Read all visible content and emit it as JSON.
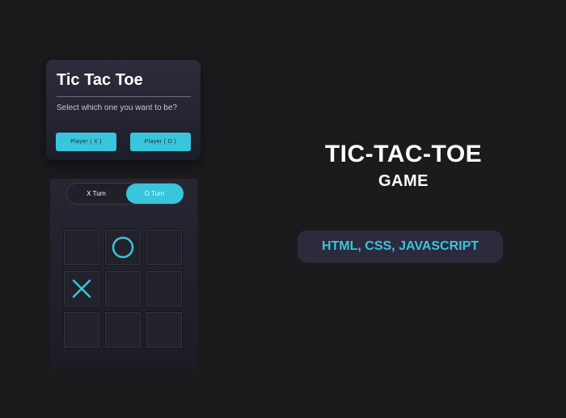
{
  "select_box": {
    "title": "Tic Tac Toe",
    "subtitle": "Select which one you want to be?",
    "player_x_label": "Player ( X )",
    "player_o_label": "Player ( O )"
  },
  "board": {
    "turn_x_label": "X Turn",
    "turn_o_label": "O Turn",
    "active_turn": "O",
    "cells": [
      "",
      "O",
      "",
      "X",
      "",
      "",
      "",
      "",
      ""
    ]
  },
  "hero": {
    "title": "TIC-TAC-TOE",
    "subtitle": "GAME",
    "tech_stack": "HTML, CSS, JAVASCRIPT"
  },
  "colors": {
    "background": "#1b1b1d",
    "accent": "#39c5db",
    "card": "#2c2c3c",
    "text": "#ffffff"
  }
}
